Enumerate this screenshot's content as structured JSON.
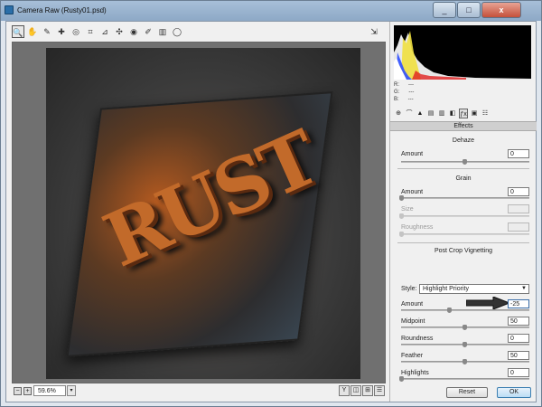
{
  "window": {
    "title": "Camera Raw (Rusty01.psd)",
    "min": "_",
    "max": "□",
    "close": "x"
  },
  "toolbar": {
    "tools": [
      {
        "name": "zoom-tool-icon",
        "glyph": "🔍"
      },
      {
        "name": "hand-tool-icon",
        "glyph": "✋"
      },
      {
        "name": "white-balance-tool-icon",
        "glyph": "✎"
      },
      {
        "name": "color-sampler-tool-icon",
        "glyph": "✚"
      },
      {
        "name": "targeted-adjustment-tool-icon",
        "glyph": "◎"
      },
      {
        "name": "crop-tool-icon",
        "glyph": "⌗"
      },
      {
        "name": "straighten-tool-icon",
        "glyph": "⊿"
      },
      {
        "name": "spot-removal-tool-icon",
        "glyph": "✣"
      },
      {
        "name": "red-eye-tool-icon",
        "glyph": "◉"
      },
      {
        "name": "adjustment-brush-icon",
        "glyph": "✐"
      },
      {
        "name": "graduated-filter-icon",
        "glyph": "▥"
      },
      {
        "name": "radial-filter-icon",
        "glyph": "◯"
      }
    ],
    "open_in_editor_glyph": "⇲"
  },
  "preview": {
    "image_text": "RUST",
    "zoom_value": "59.6%",
    "zoom_arrow": "▾"
  },
  "statusbar": {
    "zoom_out": "−",
    "zoom_in": "+",
    "view_buttons": [
      "Y",
      "◫",
      "⊞",
      "☰"
    ]
  },
  "histogram": {
    "r_label": "R:",
    "g_label": "G:",
    "b_label": "B:",
    "r_value": "---",
    "g_value": "---",
    "b_value": "---"
  },
  "panel": {
    "tabs": [
      "⊕",
      "⌒",
      "▲",
      "▤",
      "▥",
      "◧",
      "ƒx",
      "▣",
      "☷"
    ],
    "active_tab": 6,
    "header": "Effects",
    "dehaze": {
      "title": "Dehaze",
      "amount_label": "Amount",
      "amount_value": "0",
      "amount_level": 0.5
    },
    "grain": {
      "title": "Grain",
      "amount_label": "Amount",
      "amount_value": "0",
      "amount_level": 0.0,
      "size_label": "Size",
      "roughness_label": "Roughness"
    },
    "vignetting": {
      "title": "Post Crop Vignetting",
      "style_label": "Style:",
      "style_value": "Highlight Priority",
      "fields": [
        {
          "label": "Amount",
          "value": "-25",
          "level": 0.375
        },
        {
          "label": "Midpoint",
          "value": "50",
          "level": 0.5
        },
        {
          "label": "Roundness",
          "value": "0",
          "level": 0.5
        },
        {
          "label": "Feather",
          "value": "50",
          "level": 0.5
        },
        {
          "label": "Highlights",
          "value": "0",
          "level": 0.0
        }
      ]
    }
  },
  "buttons": {
    "reset": "Reset",
    "ok": "OK"
  },
  "colors": {
    "histogram_yellow": "#f0e040",
    "histogram_blue": "#3050ff",
    "histogram_red": "#e02020",
    "accent": "#3c7fb1"
  }
}
